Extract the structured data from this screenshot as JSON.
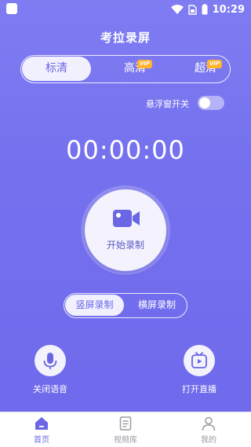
{
  "status_bar": {
    "time": "10:29"
  },
  "app_title": "考拉录屏",
  "quality": {
    "options": [
      {
        "label": "标清",
        "selected": true,
        "vip": false
      },
      {
        "label": "高清",
        "selected": false,
        "vip": true
      },
      {
        "label": "超清",
        "selected": false,
        "vip": true
      }
    ],
    "vip_badge": "VIP"
  },
  "float_window": {
    "label": "悬浮窗开关",
    "enabled": false
  },
  "timer": "00:00:00",
  "record": {
    "label": "开始录制",
    "icon": "video-camera-icon"
  },
  "orientation": {
    "options": [
      {
        "label": "竖屏录制",
        "selected": true
      },
      {
        "label": "横屏录制",
        "selected": false
      }
    ]
  },
  "actions": {
    "mute_voice": {
      "label": "关闭语音",
      "icon": "microphone-icon"
    },
    "live": {
      "label": "打开直播",
      "icon": "tv-icon"
    }
  },
  "bottom_nav": {
    "items": [
      {
        "label": "首页",
        "icon": "home-icon",
        "active": true
      },
      {
        "label": "视频库",
        "icon": "document-icon",
        "active": false
      },
      {
        "label": "我的",
        "icon": "person-icon",
        "active": false
      }
    ]
  },
  "colors": {
    "accent": "#6b66e4",
    "background_top": "#7f7cf2",
    "vip": "#ffb32e"
  }
}
